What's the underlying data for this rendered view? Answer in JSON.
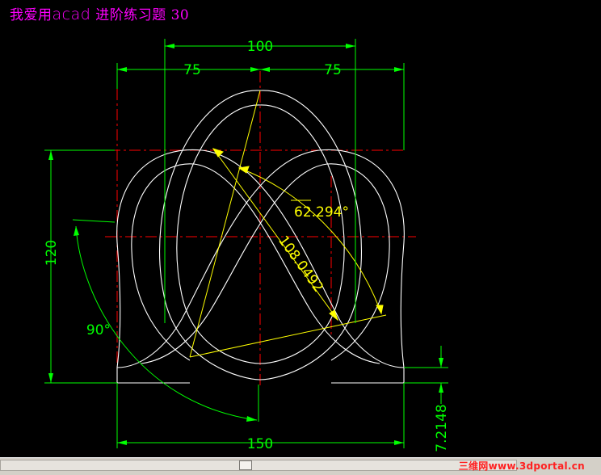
{
  "title": {
    "cn_prefix": "我爱用",
    "app": "acad",
    "cn_suffix": " 进阶练习题 30"
  },
  "dimensions": {
    "top_total": "100",
    "top_left": "75",
    "top_right": "75",
    "bottom": "150",
    "left_height": "120",
    "angle_90": "90°",
    "angle_62": "62.294°",
    "radius": "108.0492",
    "right_vertical": "7.2148"
  },
  "colors": {
    "background": "#000000",
    "geometry": "#ffffff",
    "dimension": "#00ff00",
    "construction": "#ffff00",
    "centerline": "#ff0000",
    "title": "#ff00ff"
  },
  "watermark": "三维网www.3dportal.cn"
}
